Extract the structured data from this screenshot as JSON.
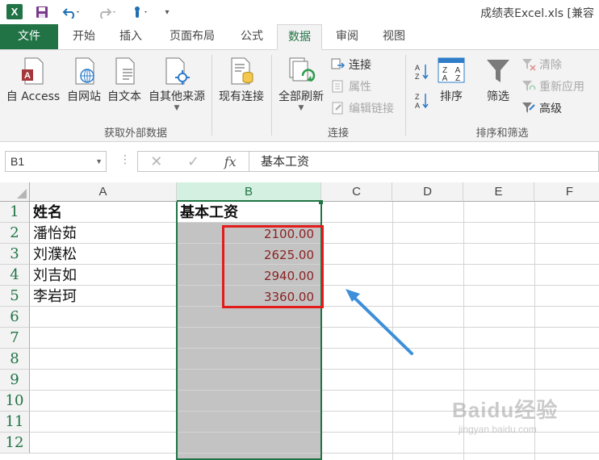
{
  "window": {
    "title": "成绩表Excel.xls  [兼容"
  },
  "tabs": [
    {
      "label": "文件"
    },
    {
      "label": "开始"
    },
    {
      "label": "插入"
    },
    {
      "label": "页面布局"
    },
    {
      "label": "公式"
    },
    {
      "label": "数据"
    },
    {
      "label": "审阅"
    },
    {
      "label": "视图"
    }
  ],
  "ribbon": {
    "get_external": {
      "from_access": "自 Access",
      "from_web": "自网站",
      "from_text": "自文本",
      "from_other": "自其他来源",
      "existing": "现有连接",
      "group_label": "获取外部数据"
    },
    "connections": {
      "refresh_all": "全部刷新",
      "connections": "连接",
      "properties": "属性",
      "edit_links": "编辑链接",
      "group_label": "连接"
    },
    "sort_filter": {
      "sort": "排序",
      "filter": "筛选",
      "clear": "清除",
      "reapply": "重新应用",
      "advanced": "高级",
      "group_label": "排序和筛选"
    }
  },
  "formula_bar": {
    "name_box": "B1",
    "fx_label": "fx",
    "content": "基本工资"
  },
  "sheet": {
    "columns": [
      "A",
      "B",
      "C",
      "D",
      "E",
      "F"
    ],
    "rows": [
      "1",
      "2",
      "3",
      "4",
      "5",
      "6",
      "7",
      "8",
      "9",
      "10",
      "11",
      "12"
    ],
    "header": {
      "name": "姓名",
      "salary": "基本工资"
    },
    "data": [
      {
        "name": "潘怡茹",
        "salary": "2100.00"
      },
      {
        "name": "刘濮松",
        "salary": "2625.00"
      },
      {
        "name": "刘吉如",
        "salary": "2940.00"
      },
      {
        "name": "李岩珂",
        "salary": "3360.00"
      }
    ]
  },
  "watermark": {
    "brand": "Baidu经验",
    "url": "jingyan.baidu.com"
  },
  "colors": {
    "excel_green": "#217346",
    "highlight_red": "#e31b1b",
    "arrow_blue": "#3d8fd9"
  }
}
